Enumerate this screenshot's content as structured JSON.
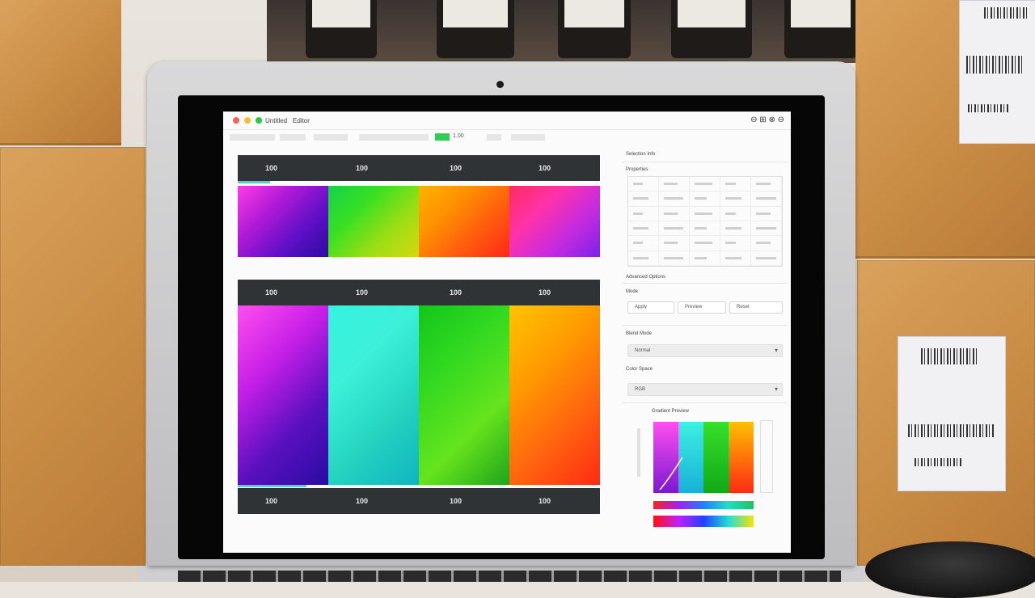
{
  "scene": {
    "colors": {
      "cardboard": "#c98c45",
      "laptop_shell": "#d0d0d2",
      "bezel": "#060606"
    }
  },
  "app": {
    "title": "Untitled",
    "tab": "Editor",
    "window_controls": "⊖ ⊞ ⊗ ⊖",
    "toolbar_value": "1.00"
  },
  "panel_top": {
    "labels": [
      "100",
      "100",
      "100",
      "100"
    ],
    "progress": 0.09,
    "swatch_colors": [
      [
        "#ff3be6",
        "#b21bd8",
        "#6010c8",
        "#2d0aa0"
      ],
      [
        "#17d04a",
        "#38e023",
        "#9bde14",
        "#d6d80f"
      ],
      [
        "#ffb300",
        "#ff9000",
        "#ff5a10",
        "#ff2818"
      ],
      [
        "#ff2a60",
        "#ff33a8",
        "#c42ce0",
        "#7a22e8"
      ]
    ]
  },
  "panel_bottom": {
    "labels": [
      "100",
      "100",
      "100",
      "100"
    ],
    "footer_labels": [
      "100",
      "100",
      "100",
      "100"
    ],
    "progress": 0.19,
    "swatch_colors": [
      [
        "#ff4ef0",
        "#c71fe8",
        "#5a10c0",
        "#2a0ba2"
      ],
      [
        "#35f2e0",
        "#3df0d8",
        "#23d3c0",
        "#10b4c0"
      ],
      [
        "#12c61a",
        "#33d920",
        "#66e41d",
        "#1fa41b"
      ],
      [
        "#ffc400",
        "#ff9c00",
        "#ff6410",
        "#ff2a14"
      ]
    ]
  },
  "sidebar": {
    "section_1": "Selection Info",
    "section_1_sub": "Properties",
    "section_2": "Advanced Options",
    "section_2_sub": "Mode",
    "buttons": [
      "Apply",
      "Preview",
      "Reset"
    ],
    "section_3": "Blend Mode",
    "select_1": "Normal",
    "section_4": "Color Space",
    "select_2": "RGB",
    "preview_title": "Gradient Preview",
    "icons": [
      "chevron-down-icon",
      "chevron-down-icon"
    ]
  }
}
